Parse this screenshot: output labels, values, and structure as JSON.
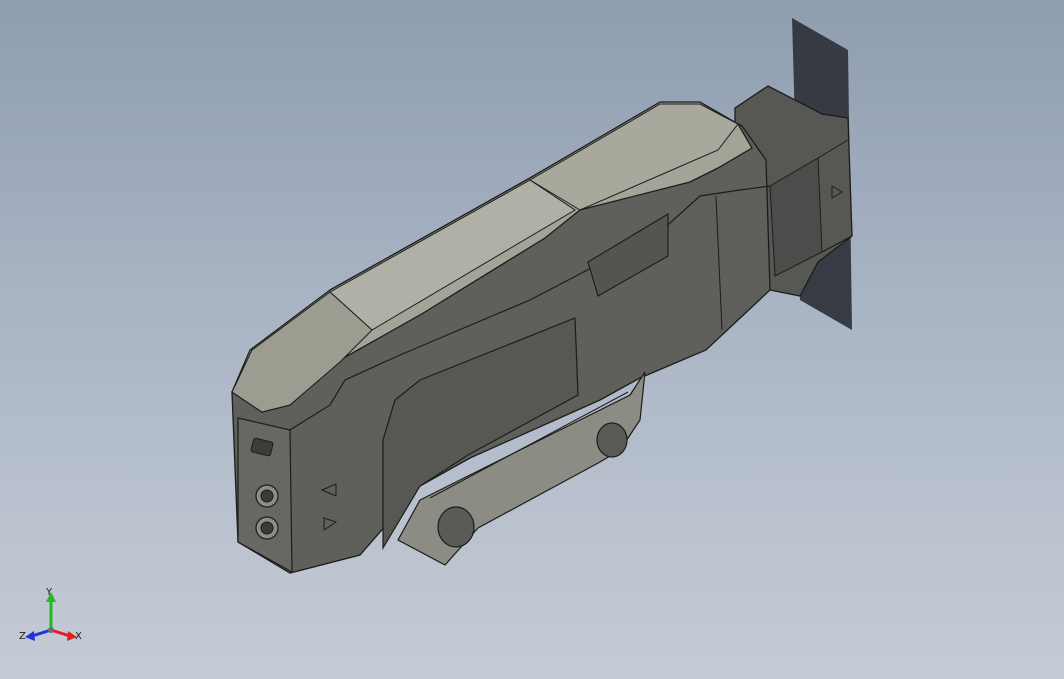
{
  "viewport": {
    "background_top": "#8f9db0",
    "background_bottom": "#c6ccd6",
    "model": {
      "body_color": "#5d5d5a",
      "top_color": "#a6a69b",
      "edge_color": "#1c1c1c",
      "shadow_color": "#2b2f36"
    }
  },
  "triad": {
    "x_label": "X",
    "y_label": "Y",
    "z_label": "Z",
    "x_color": "#e0201e",
    "y_color": "#22b822",
    "z_color": "#2233d8"
  }
}
